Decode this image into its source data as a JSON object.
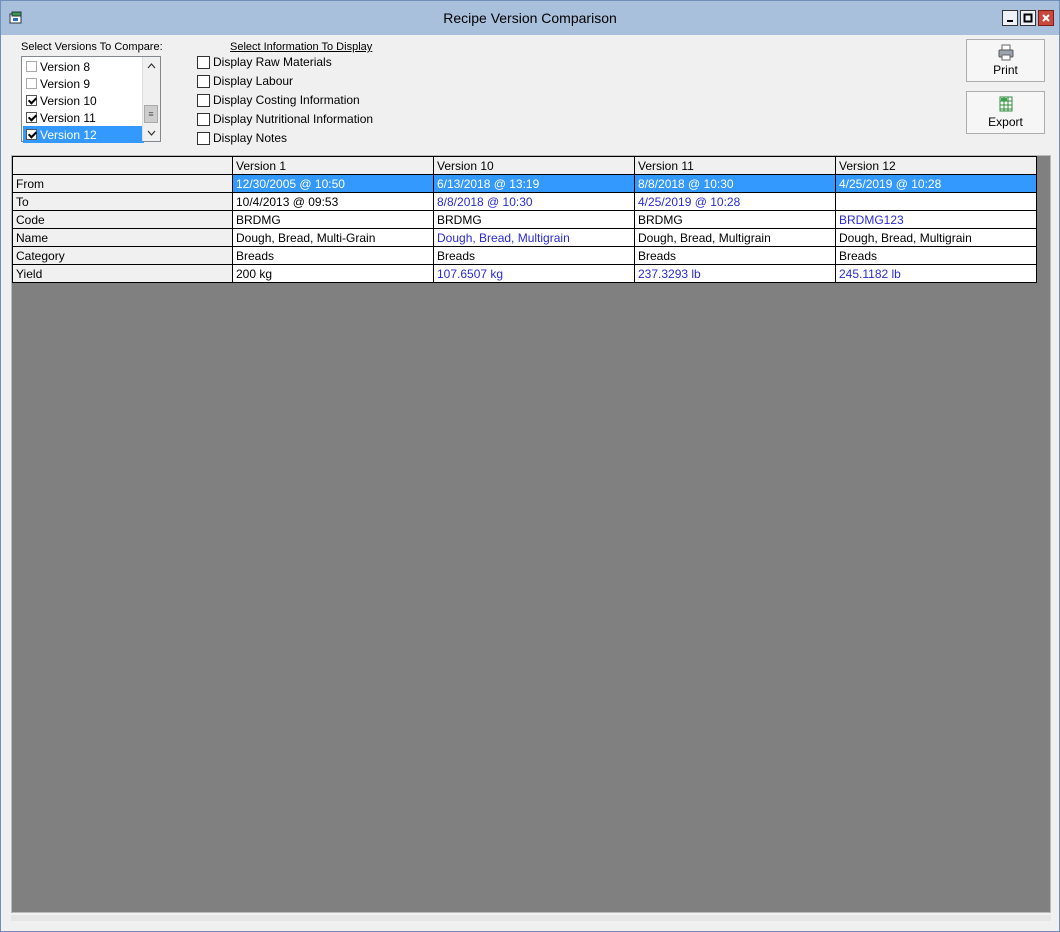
{
  "window": {
    "title": "Recipe Version Comparison",
    "icon": "recipe-app-icon"
  },
  "versions_panel": {
    "label": "Select Versions To Compare:",
    "items": [
      {
        "label": "Version 8",
        "checked": false
      },
      {
        "label": "Version 9",
        "checked": false
      },
      {
        "label": "Version 10",
        "checked": true
      },
      {
        "label": "Version 11",
        "checked": true
      },
      {
        "label": "Version 12",
        "checked": true,
        "selected": true
      }
    ]
  },
  "info_panel": {
    "label": "Select Information To Display",
    "options": [
      {
        "label": "Display Raw Materials",
        "checked": false
      },
      {
        "label": "Display Labour",
        "checked": false
      },
      {
        "label": "Display Costing Information",
        "checked": false
      },
      {
        "label": "Display Nutritional Information",
        "checked": false
      },
      {
        "label": "Display Notes",
        "checked": false
      }
    ]
  },
  "buttons": {
    "print": "Print",
    "export": "Export"
  },
  "grid": {
    "columns": [
      "Version 1",
      "Version 10",
      "Version 11",
      "Version 12"
    ],
    "rows": [
      {
        "label": "From",
        "cells": [
          "12/30/2005 @ 10:50",
          "6/13/2018 @ 13:19",
          "8/8/2018 @ 10:30",
          "4/25/2019 @ 10:28"
        ],
        "changed": [
          false,
          false,
          false,
          false
        ]
      },
      {
        "label": "To",
        "cells": [
          "10/4/2013 @ 09:53",
          "8/8/2018 @ 10:30",
          "4/25/2019 @ 10:28",
          ""
        ],
        "changed": [
          false,
          true,
          true,
          false
        ]
      },
      {
        "label": "Code",
        "cells": [
          "BRDMG",
          "BRDMG",
          "BRDMG",
          "BRDMG123"
        ],
        "changed": [
          false,
          false,
          false,
          true
        ]
      },
      {
        "label": "Name",
        "cells": [
          "Dough, Bread, Multi-Grain",
          "Dough, Bread, Multigrain",
          "Dough, Bread, Multigrain",
          "Dough, Bread, Multigrain"
        ],
        "changed": [
          false,
          true,
          false,
          false
        ]
      },
      {
        "label": "Category",
        "cells": [
          "Breads",
          "Breads",
          "Breads",
          "Breads"
        ],
        "changed": [
          false,
          false,
          false,
          false
        ]
      },
      {
        "label": "Yield",
        "cells": [
          "200 kg",
          "107.6507 kg",
          "237.3293 lb",
          "245.1182 lb"
        ],
        "changed": [
          false,
          true,
          true,
          true
        ]
      }
    ],
    "selected_row": "From"
  },
  "colors": {
    "selection": "#3399ff",
    "changed_text": "#2a2ad4",
    "grid_background": "#808080",
    "titlebar": "#a9c0dc"
  }
}
